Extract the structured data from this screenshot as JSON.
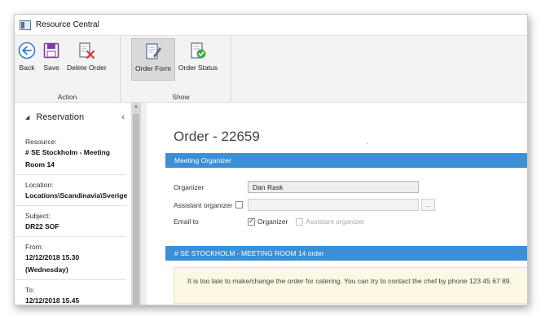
{
  "window": {
    "title": "Resource Central"
  },
  "ribbon": {
    "action": {
      "label": "Action",
      "buttons": [
        {
          "label": "Back",
          "icon": "back-arrow-icon"
        },
        {
          "label": "Save",
          "icon": "save-disk-icon"
        },
        {
          "label": "Delete Order",
          "icon": "delete-order-icon"
        }
      ]
    },
    "show": {
      "label": "Show",
      "buttons": [
        {
          "label": "Order Form",
          "icon": "order-form-icon",
          "active": true
        },
        {
          "label": "Order Status",
          "icon": "order-status-icon",
          "active": false
        }
      ]
    }
  },
  "sidebar": {
    "header": "Reservation",
    "collapse_glyph": "‹",
    "fields": [
      {
        "label": "Resource:",
        "value_lines": [
          "# SE Stockholm - Meeting",
          "Room 14"
        ]
      },
      {
        "label": "Location:",
        "value_lines": [
          "Locations\\Scandinavia\\Sverige"
        ]
      },
      {
        "label": "Subject:",
        "value_lines": [
          "DR22 SOF"
        ]
      },
      {
        "label": "From:",
        "value_lines": [
          "12/12/2018 15.30",
          "(Wednesday)"
        ]
      },
      {
        "label": "To:",
        "value_lines": [
          "12/12/2018 15.45"
        ]
      }
    ]
  },
  "main": {
    "order_title": "Order - 22659",
    "section1_title": "Meeting Organizer",
    "organizer_label": "Organizer",
    "organizer_value": "Dan Rask",
    "assistant_label": "Assistant organizer",
    "assistant_value": "",
    "ellipsis": "...",
    "email_label": "Email to",
    "email_options": [
      {
        "label": "Organizer",
        "checked": true,
        "enabled": true
      },
      {
        "label": "Assistant organizer",
        "checked": false,
        "enabled": false
      }
    ],
    "section2_title": "# SE STOCKHOLM - MEETING ROOM 14 order",
    "notice": "It is too late to make/change the order for catering. You can try to contact the chef by phone 123 45 67 89."
  },
  "colors": {
    "section_bar": "#3b8fd6",
    "notice_bg": "#fcf8e3",
    "back_icon": "#2f7fd1",
    "save_icon": "#7a3fa0",
    "delete_icon": "#d9382e",
    "status_icon": "#4aa54a"
  }
}
